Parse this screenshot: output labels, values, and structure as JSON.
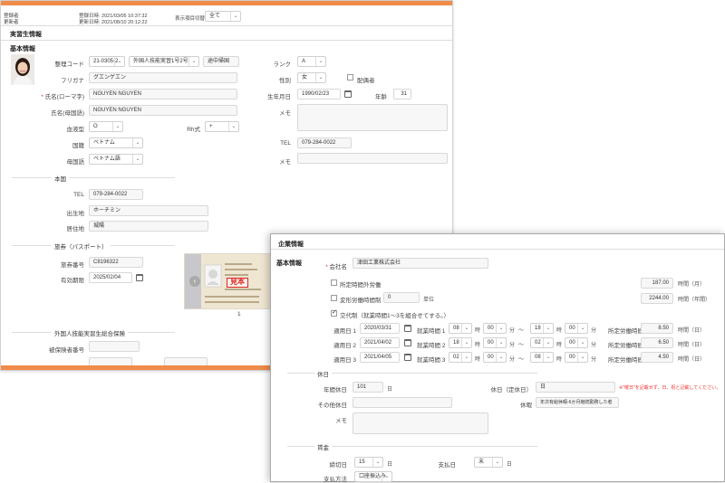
{
  "w1": {
    "meta": {
      "reg_label": "登録者",
      "upd_label": "更新者",
      "reg_date": "登録日時: 2021/03/05 10:37:32",
      "upd_date": "更新日時: 2021/08/10 20:12:22",
      "switch_label": "表示項目切替",
      "switch_value": "全て"
    },
    "title": "実習生情報",
    "basic": {
      "heading": "基本情報",
      "code_label": "整理コード",
      "code": "21-0305-2",
      "org": "外国人技能実習1号2号",
      "status": "途中帰国",
      "rank_label": "ランク",
      "rank": "A",
      "kana_label": "フリガナ",
      "kana": "グエンゲエン",
      "sex_label": "性別",
      "sex": "女",
      "spouse_label": "配偶者",
      "name_label": "氏名(ローマ字)",
      "name": "NGUYEN NGUYEN",
      "birth_label": "生年月日",
      "birth": "1990/02/23",
      "age_label": "年齢",
      "age": "31",
      "native_label": "氏名(母国語)",
      "native": "NGUYEN NGUYEN",
      "memo_label": "メモ",
      "blood_label": "血液型",
      "blood": "O",
      "rh_label": "Rh式",
      "rh": "+",
      "nat_label": "国籍",
      "nat": "ベトナム",
      "tel_label": "TEL",
      "tel": "079-284-0022",
      "lang_label": "母国語",
      "lang": "ベトナム語",
      "memo2_label": "メモ"
    },
    "home": {
      "heading": "本国",
      "tel_label": "TEL",
      "tel": "079-284-0022",
      "birthplace_label": "出生地",
      "birthplace": "ホーチミン",
      "address_label": "居住地",
      "address": "城陽"
    },
    "passport": {
      "heading": "旅券（パスポート）",
      "no_label": "旅券番号",
      "no": "C8196322",
      "exp_label": "有効期限",
      "exp": "2025/02/04",
      "stamp": "見本",
      "page": "1"
    },
    "insurance": {
      "heading": "外国人技能実習生総合保険",
      "no_label": "被保険者番号"
    }
  },
  "w2": {
    "title": "企業情報",
    "heading": "基本情報",
    "company_label": "会社名",
    "company": "津田工業株式会社",
    "ot_label": "所定時間外労働",
    "flex_label": "変形労働時間制",
    "flex_value": "0",
    "flex_unit": "単位",
    "monthly_value": "187.00",
    "monthly_unit": "時間（月）",
    "yearly_value": "2244.00",
    "yearly_unit": "時間（年間）",
    "shift_label": "交代制（就業時間1～3を組合せてする。）",
    "periods": [
      {
        "label": "適用日 1",
        "date": "2020/03/31",
        "work": "就業時間 1",
        "sh": "08",
        "sm": "00",
        "eh": "18",
        "em": "00",
        "total": "8.50"
      },
      {
        "label": "適用日 2",
        "date": "2021/04/02",
        "work": "就業時間 2",
        "sh": "18",
        "sm": "00",
        "eh": "02",
        "em": "00",
        "total": "6.50"
      },
      {
        "label": "適用日 3",
        "date": "2021/04/05",
        "work": "就業時間 3",
        "sh": "02",
        "sm": "00",
        "eh": "08",
        "em": "00",
        "total": "4.50"
      }
    ],
    "u_hour": "時",
    "u_min": "分",
    "u_tilde": "～",
    "total_label": "所定労働時間",
    "total_unit": "時間（日）",
    "holiday_heading": "休日",
    "annual_label": "年間休日",
    "annual": "101",
    "annual_unit": "日",
    "weekly_label": "休日（定休日）",
    "weekly": "日",
    "weekly_note": "※\"曜日\"を記載せず、日、祝と記載してください。",
    "other_label": "その他休日",
    "leave_label": "休暇",
    "leave": "年次有給休暇-6か月継続勤務した者",
    "memo_label": "メモ",
    "pay_heading": "賃金",
    "cutoff_label": "締切日",
    "cutoff": "15",
    "cutoff_unit": "日",
    "payday_label": "支払日",
    "payday": "末",
    "payday_unit": "日",
    "method_label": "支払方法",
    "method": "口座振込み"
  }
}
